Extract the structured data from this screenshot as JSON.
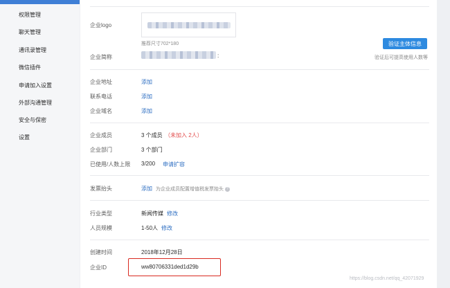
{
  "sidebar": {
    "items": [
      {
        "label": "权限管理"
      },
      {
        "label": "聊天管理"
      },
      {
        "label": "通讯录管理"
      },
      {
        "label": "微信插件"
      },
      {
        "label": "申请加入设置"
      },
      {
        "label": "外部沟通管理"
      },
      {
        "label": "安全与保密"
      },
      {
        "label": "设置"
      }
    ],
    "accent_color": "#3f7fd6"
  },
  "profile": {
    "logo": {
      "label": "企业logo",
      "hint": "推荐尺寸702*180"
    },
    "verify_button": "验证主体信息",
    "verify_hint": "验证后可提高使用人数等",
    "short_name": {
      "label": "企业简称",
      "suffix": ":"
    }
  },
  "contact": {
    "address": {
      "label": "企业地址",
      "action": "添加"
    },
    "phone": {
      "label": "联系电话",
      "action": "添加"
    },
    "domain": {
      "label": "企业域名",
      "action": "添加"
    }
  },
  "org": {
    "members": {
      "label": "企业成员",
      "value": "3 个成员",
      "note": "（未加入 2人）"
    },
    "departments": {
      "label": "企业部门",
      "value": "3 个部门"
    },
    "limit": {
      "label": "已使用/人数上限",
      "value": "3/200",
      "action": "申请扩容"
    }
  },
  "invoice": {
    "label": "发票抬头",
    "action": "添加",
    "note": "为企业成员配置增值税发票抬头",
    "icon": "help-icon"
  },
  "industry": {
    "type": {
      "label": "行业类型",
      "value": "新闻传媒",
      "action": "修改"
    },
    "size": {
      "label": "人员规模",
      "value": "1-50人",
      "action": "修改"
    }
  },
  "meta": {
    "created": {
      "label": "创建时间",
      "value": "2018年12月28日"
    },
    "corp_id": {
      "label": "企业ID",
      "value": "ww80706331ded1d29b"
    }
  },
  "watermark": "https://blog.csdn.net/qq_42071929",
  "colors": {
    "link": "#2d6ec2",
    "button": "#2d8ae0",
    "highlight_box": "#d8281f",
    "warn": "#e24d4d"
  }
}
